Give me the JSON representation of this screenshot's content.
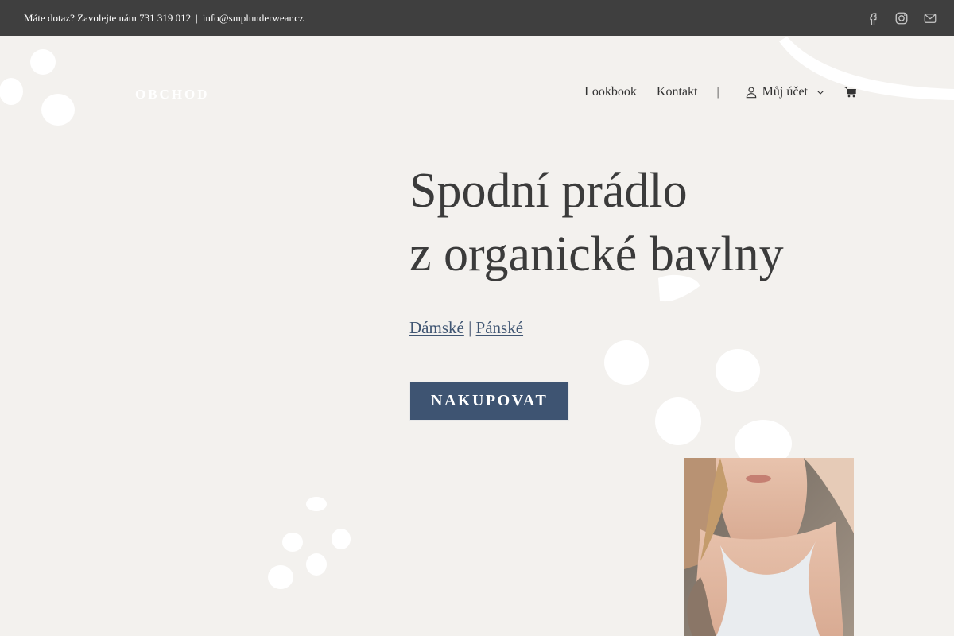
{
  "topbar": {
    "contact_text": "Máte dotaz? Zavolejte nám 731 319 012",
    "separator": "|",
    "email": "info@smplunderwear.cz",
    "social_icons": [
      "facebook-icon",
      "instagram-icon",
      "envelope-icon"
    ]
  },
  "nav": {
    "logo": "OBCHOD",
    "items": [
      {
        "label": "Lookbook"
      },
      {
        "label": "Kontakt"
      }
    ],
    "separator": "|",
    "account_label": "Můj účet",
    "account_icon": "user-icon",
    "cart_icon": "cart-icon"
  },
  "hero": {
    "title_line1": "Spodní prádlo",
    "title_line2": "z organické bavlny",
    "link_women": "Dámské",
    "link_separator": "|",
    "link_men": "Pánské",
    "cta_label": "NAKUPOVAT"
  },
  "colors": {
    "background": "#f3f1ee",
    "topbar": "#3f3f3f",
    "accent": "#3e5472",
    "text": "#3b3b3b"
  }
}
